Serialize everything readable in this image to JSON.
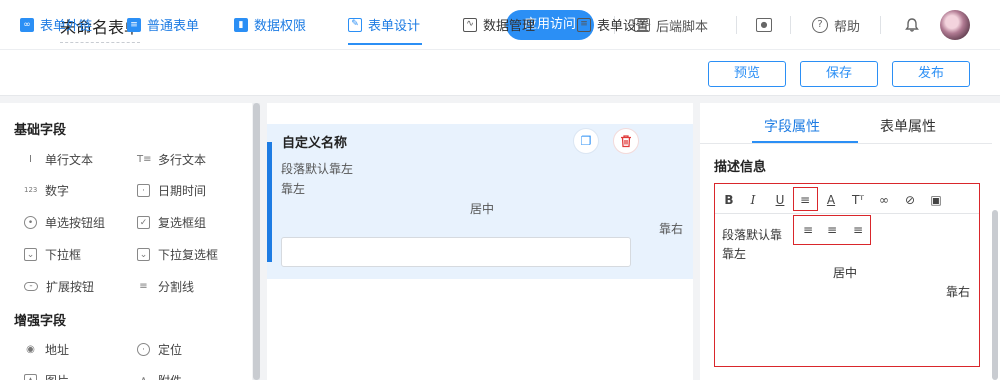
{
  "header": {
    "back_icon": "chevron-left-icon",
    "title": "未命名表单",
    "app_visit": "应用访问",
    "backend_script": "后端脚本",
    "help": "帮助"
  },
  "nav": {
    "items": [
      {
        "label": "表单外链",
        "icon": "link-icon"
      },
      {
        "label": "普通表单",
        "icon": "form-icon"
      },
      {
        "label": "数据权限",
        "icon": "bar-chart-icon"
      },
      {
        "label": "表单设计",
        "icon": "edit-icon"
      },
      {
        "label": "数据管理",
        "icon": "line-chart-icon"
      },
      {
        "label": "表单设置",
        "icon": "settings-doc-icon"
      }
    ],
    "active": "表单设计",
    "preview": "预览",
    "save": "保存",
    "publish": "发布"
  },
  "left": {
    "basic_title": "基础字段",
    "basic_fields": [
      "单行文本",
      "多行文本",
      "数字",
      "日期时间",
      "单选按钮组",
      "复选框组",
      "下拉框",
      "下拉复选框",
      "扩展按钮",
      "分割线"
    ],
    "enhanced_title": "增强字段",
    "enhanced_fields": [
      "地址",
      "定位",
      "图片",
      "附件"
    ]
  },
  "canvas": {
    "field_title": "自定义名称",
    "para": "段落默认靠左",
    "left": "靠左",
    "center": "居中",
    "right": "靠右"
  },
  "right": {
    "tabs": [
      "字段属性",
      "表单属性"
    ],
    "active_tab": "字段属性",
    "desc_label": "描述信息",
    "toolbar": [
      "B",
      "I",
      "U",
      "align",
      "A",
      "T",
      "link",
      "unlink",
      "image"
    ],
    "content": {
      "para": "段落默认靠",
      "left": "靠左",
      "center": "居中",
      "right": "靠右"
    }
  },
  "colors": {
    "accent": "#2b8ff5",
    "danger": "#d9262b",
    "selected_bg": "#e8f2fd"
  }
}
